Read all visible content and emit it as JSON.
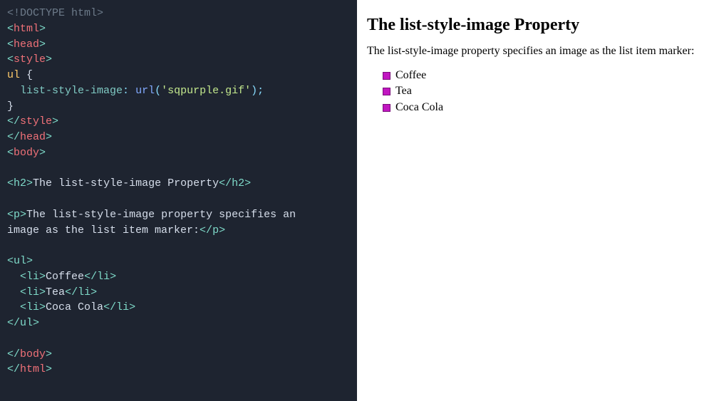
{
  "code": {
    "l1_a": "<!",
    "l1_b": "DOCTYPE",
    "l1_c": " html",
    "l1_d": ">",
    "l2_a": "<",
    "l2_b": "html",
    "l2_c": ">",
    "l3_a": "<",
    "l3_b": "head",
    "l3_c": ">",
    "l4_a": "<",
    "l4_b": "style",
    "l4_c": ">",
    "l5_a": "ul",
    "l5_b": " {",
    "l6_a": "  ",
    "l6_b": "list-style-image",
    "l6_c": ": ",
    "l6_d": "url",
    "l6_e": "(",
    "l6_f": "'sqpurple.gif'",
    "l6_g": ")",
    "l6_h": ";",
    "l7_a": "}",
    "l8_a": "</",
    "l8_b": "style",
    "l8_c": ">",
    "l9_a": "</",
    "l9_b": "head",
    "l9_c": ">",
    "l10_a": "<",
    "l10_b": "body",
    "l10_c": ">",
    "blank": "",
    "l12_a": "<",
    "l12_b": "h2",
    "l12_c": ">",
    "l12_d": "The list-style-image Property",
    "l12_e": "</",
    "l12_f": "h2",
    "l12_g": ">",
    "l14_a": "<",
    "l14_b": "p",
    "l14_c": ">",
    "l14_d": "The list-style-image property specifies an\nimage as the list item marker:",
    "l14_e": "</",
    "l14_f": "p",
    "l14_g": ">",
    "l16_a": "<",
    "l16_b": "ul",
    "l16_c": ">",
    "l17_a": "  <",
    "l17_b": "li",
    "l17_c": ">",
    "l17_d": "Coffee",
    "l17_e": "</",
    "l17_f": "li",
    "l17_g": ">",
    "l18_a": "  <",
    "l18_b": "li",
    "l18_c": ">",
    "l18_d": "Tea",
    "l18_e": "</",
    "l18_f": "li",
    "l18_g": ">",
    "l19_a": "  <",
    "l19_b": "li",
    "l19_c": ">",
    "l19_d": "Coca Cola",
    "l19_e": "</",
    "l19_f": "li",
    "l19_g": ">",
    "l20_a": "</",
    "l20_b": "ul",
    "l20_c": ">",
    "l22_a": "</",
    "l22_b": "body",
    "l22_c": ">",
    "l23_a": "</",
    "l23_b": "html",
    "l23_c": ">"
  },
  "preview": {
    "heading": "The list-style-image Property",
    "paragraph": "The list-style-image property specifies an image as the list item marker:",
    "items": {
      "i0": "Coffee",
      "i1": "Tea",
      "i2": "Coca Cola"
    }
  }
}
